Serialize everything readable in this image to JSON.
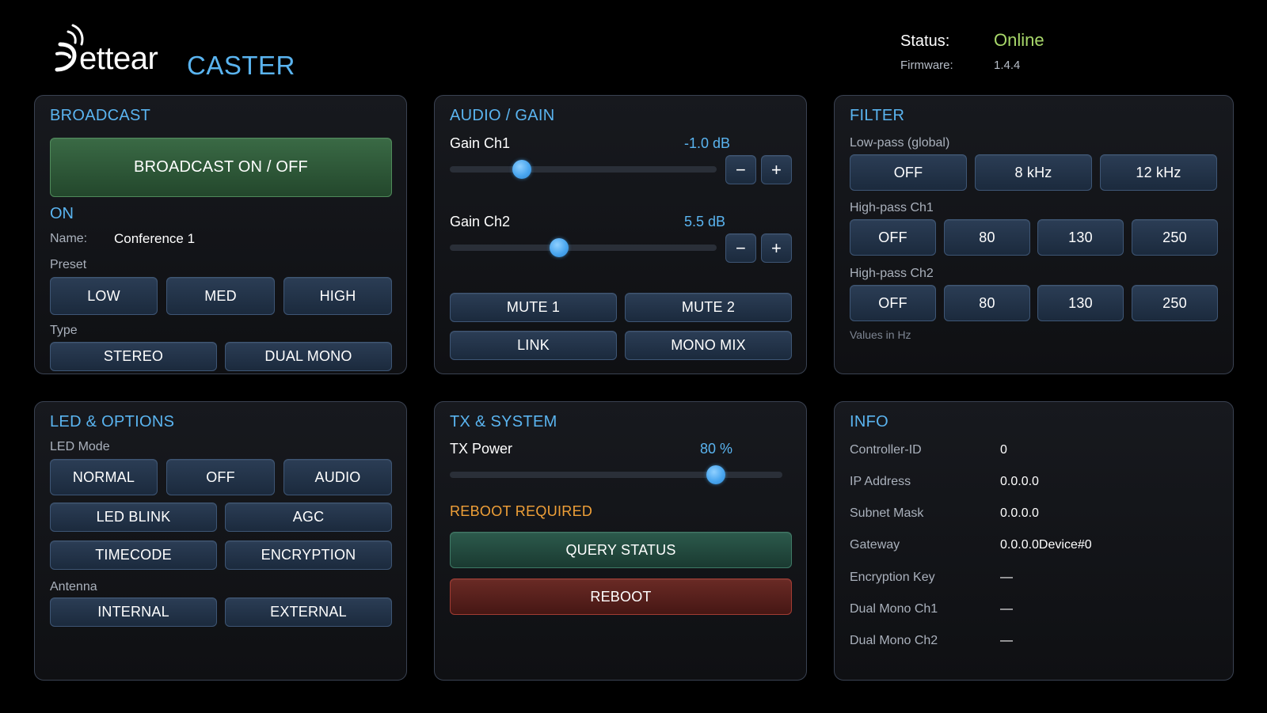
{
  "header": {
    "logo_text": "ettear",
    "app_name": "CASTER",
    "status_label": "Status:",
    "status_value": "Online",
    "firmware_label": "Firmware:",
    "firmware_value": "1.4.4",
    "status_color": "#a8d86a",
    "accent_color": "#5ab4f0"
  },
  "broadcast": {
    "title": "BROADCAST",
    "toggle_label": "BROADCAST ON / OFF",
    "state": "ON",
    "name_label": "Name:",
    "name_value": "Conference 1",
    "preset_label": "Preset",
    "presets": [
      "LOW",
      "MED",
      "HIGH"
    ],
    "type_label": "Type",
    "types": [
      "STEREO",
      "DUAL MONO"
    ]
  },
  "audio": {
    "title": "AUDIO / GAIN",
    "ch1_label": "Gain Ch1",
    "ch1_value": "-1.0 dB",
    "ch1_level": 0.27,
    "ch2_label": "Gain Ch2",
    "ch2_value": "5.5 dB",
    "ch2_level": 0.41,
    "minus": "−",
    "plus": "+",
    "mute1": "MUTE 1",
    "mute2": "MUTE 2",
    "link": "LINK",
    "mono_mix": "MONO MIX"
  },
  "filter": {
    "title": "FILTER",
    "lowpass_label": "Low-pass (global)",
    "lowpass": [
      "OFF",
      "8 kHz",
      "12 kHz"
    ],
    "hp1_label": "High-pass Ch1",
    "hp1": [
      "OFF",
      "80",
      "130",
      "250"
    ],
    "hp2_label": "High-pass Ch2",
    "hp2": [
      "OFF",
      "80",
      "130",
      "250"
    ],
    "note": "Values in Hz"
  },
  "led": {
    "title": "LED & OPTIONS",
    "mode_label": "LED Mode",
    "modes": [
      "NORMAL",
      "OFF",
      "AUDIO"
    ],
    "options": [
      "LED BLINK",
      "AGC",
      "TIMECODE",
      "ENCRYPTION"
    ],
    "antenna_label": "Antenna",
    "antennas": [
      "INTERNAL",
      "EXTERNAL"
    ]
  },
  "tx": {
    "title": "TX & SYSTEM",
    "power_label": "TX Power",
    "power_value": "80 %",
    "power_level": 0.8,
    "reboot_required": "REBOOT REQUIRED",
    "query_status": "QUERY STATUS",
    "reboot": "REBOOT",
    "warning_color": "#f0a038"
  },
  "info": {
    "title": "INFO",
    "rows": [
      {
        "key": "Controller-ID",
        "value": "0"
      },
      {
        "key": "IP Address",
        "value": "0.0.0.0"
      },
      {
        "key": "Subnet Mask",
        "value": "0.0.0.0"
      },
      {
        "key": "Gateway",
        "value": "0.0.0.0Device#0"
      },
      {
        "key": "Encryption Key",
        "value": "—"
      },
      {
        "key": "Dual Mono Ch1",
        "value": "—"
      },
      {
        "key": "Dual Mono Ch2",
        "value": "—"
      }
    ]
  }
}
